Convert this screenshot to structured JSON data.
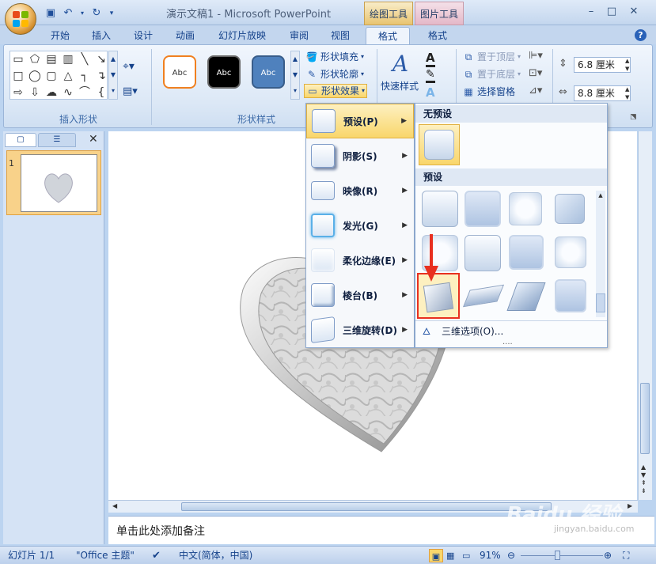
{
  "window": {
    "title": "演示文稿1 - Microsoft PowerPoint",
    "context_tabs": [
      "绘图工具",
      "图片工具"
    ],
    "min": "–",
    "max": "□",
    "close": "✕"
  },
  "tabs": [
    "开始",
    "插入",
    "设计",
    "动画",
    "幻灯片放映",
    "审阅",
    "视图",
    "格式",
    "格式"
  ],
  "ribbon": {
    "insert_shapes_label": "插入形状",
    "shape_styles_label": "形状样式",
    "style_sample": "Abc",
    "shape_fill": "形状填充",
    "shape_outline": "形状轮廓",
    "shape_effects": "形状效果",
    "quick_styles": "快速样式",
    "bring_front": "置于顶层",
    "send_back": "置于底层",
    "selection_pane": "选择窗格",
    "height": "6.8 厘米",
    "width": "8.8 厘米"
  },
  "menu": {
    "items": [
      "预设(P)",
      "阴影(S)",
      "映像(R)",
      "发光(G)",
      "柔化边缘(E)",
      "棱台(B)",
      "三维旋转(D)"
    ]
  },
  "submenu": {
    "no_preset": "无预设",
    "preset": "预设",
    "options": "三维选项(O)...",
    "more": "...."
  },
  "slide_panel": {
    "slide_number": "1"
  },
  "notes": {
    "placeholder": "单击此处添加备注"
  },
  "status": {
    "slide": "幻灯片 1/1",
    "theme": "\"Office 主题\"",
    "language": "中文(简体，中国)",
    "zoom": "91%"
  },
  "watermark": "Baidu 经验",
  "watermark_sub": "jingyan.baidu.com"
}
